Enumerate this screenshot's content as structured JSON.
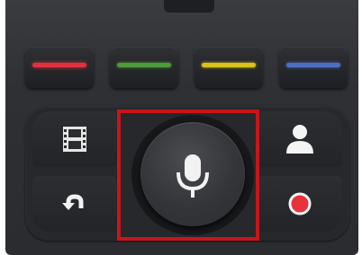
{
  "remote": {
    "color_buttons": [
      {
        "name": "red",
        "color": "#e0323f"
      },
      {
        "name": "green",
        "color": "#4c9a3a"
      },
      {
        "name": "yellow",
        "color": "#d8c21e"
      },
      {
        "name": "blue",
        "color": "#4b6fc2"
      }
    ],
    "left_buttons": [
      {
        "icon": "film-icon"
      },
      {
        "icon": "back-arrow-icon"
      }
    ],
    "right_buttons": [
      {
        "icon": "person-icon"
      },
      {
        "icon": "record-icon",
        "color": "#e8323c"
      }
    ],
    "center_button": {
      "icon": "microphone-icon"
    },
    "highlight_color": "#c8151b"
  }
}
